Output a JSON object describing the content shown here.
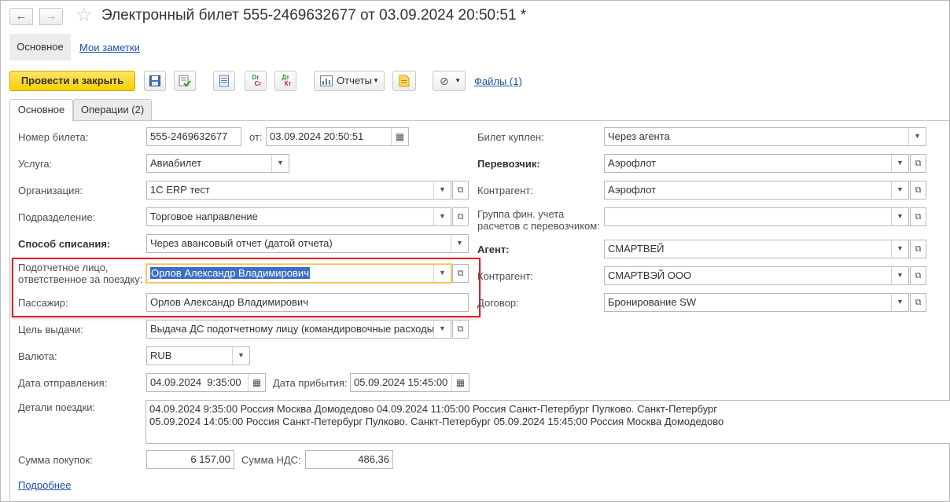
{
  "window": {
    "title": "Электронный билет 555-2469632677 от 03.09.2024 20:50:51 *",
    "nav_back": "←",
    "nav_forward": "→",
    "favorite_icon": "star-icon"
  },
  "sections": {
    "main": "Основное",
    "notes": "Мои заметки"
  },
  "toolbar": {
    "post_close": "Провести и закрыть",
    "save_icon": "save-icon",
    "post_icon": "post-icon",
    "list_icon": "list-icon",
    "dr_cr_top": "Dr",
    "dr_cr_bottom": "Cr",
    "dt_kt_top": "Дт",
    "dt_kt_bottom": "Кт",
    "reports": "Отчеты",
    "note_icon": "note-icon",
    "attach_icon": "paperclip-icon",
    "files": "Файлы (1)"
  },
  "tabs": [
    {
      "label": "Основное",
      "active": true
    },
    {
      "label": "Операции (2)",
      "active": false
    }
  ],
  "left": {
    "ticket_number": {
      "label": "Номер билета:",
      "value": "555-2469632677"
    },
    "ticket_date": {
      "label": "от:",
      "value": "03.09.2024 20:50:51"
    },
    "service": {
      "label": "Услуга:",
      "value": "Авиабилет"
    },
    "organization": {
      "label": "Организация:",
      "value": "1С ERP тест"
    },
    "department": {
      "label": "Подразделение:",
      "value": "Торговое направление"
    },
    "writeoff_method": {
      "label": "Способ списания:",
      "value": "Через авансовый отчет (датой отчета)"
    },
    "accountable": {
      "label_line1": "Подотчетное лицо,",
      "label_line2": "ответственное за поездку:",
      "value": "Орлов Александр Владимирович"
    },
    "passenger": {
      "label": "Пассажир:",
      "value": "Орлов Александр Владимирович"
    },
    "purpose": {
      "label": "Цель выдачи:",
      "value": "Выдача ДС подотчетному лицу (командировочные расходы)"
    },
    "currency": {
      "label": "Валюта:",
      "value": "RUB"
    },
    "departure_date": {
      "label": "Дата отправления:",
      "value": "04.09.2024  9:35:00"
    },
    "arrival_date": {
      "label": "Дата прибытия:",
      "value": "05.09.2024 15:45:00"
    },
    "trip_details": {
      "label": "Детали поездки:",
      "line1": "04.09.2024 9:35:00 Россия Москва Домодедово 04.09.2024 11:05:00 Россия Санкт-Петербург Пулково. Санкт-Петербург",
      "line2": "05.09.2024 14:05:00 Россия Санкт-Петербург Пулково. Санкт-Петербург 05.09.2024 15:45:00 Россия Москва Домодедово"
    },
    "purchase_sum": {
      "label": "Сумма покупок:",
      "value": "6 157,00"
    },
    "vat_sum": {
      "label": "Сумма НДС:",
      "value": "486,36"
    },
    "more_link": "Подробнее"
  },
  "right": {
    "bought": {
      "label": "Билет куплен:",
      "value": "Через агента"
    },
    "carrier": {
      "label": "Перевозчик:",
      "value": "Аэрофлот"
    },
    "carrier_counterparty": {
      "label": "Контрагент:",
      "value": "Аэрофлот"
    },
    "fin_group": {
      "label_line1": "Группа фин. учета",
      "label_line2": "расчетов с перевозчиком:",
      "value": ""
    },
    "agent": {
      "label": "Агент:",
      "value": "СМАРТВЕЙ"
    },
    "agent_counterparty": {
      "label": "Контрагент:",
      "value": "СМАРТВЭЙ ООО"
    },
    "contract": {
      "label": "Договор:",
      "value": "Бронирование SW"
    }
  },
  "colors": {
    "primary_button": "#f7d000",
    "highlight_border": "#dd2222",
    "link": "#1e4fa8",
    "focus_border": "#f0c24a",
    "selection": "#3b6fc4"
  }
}
